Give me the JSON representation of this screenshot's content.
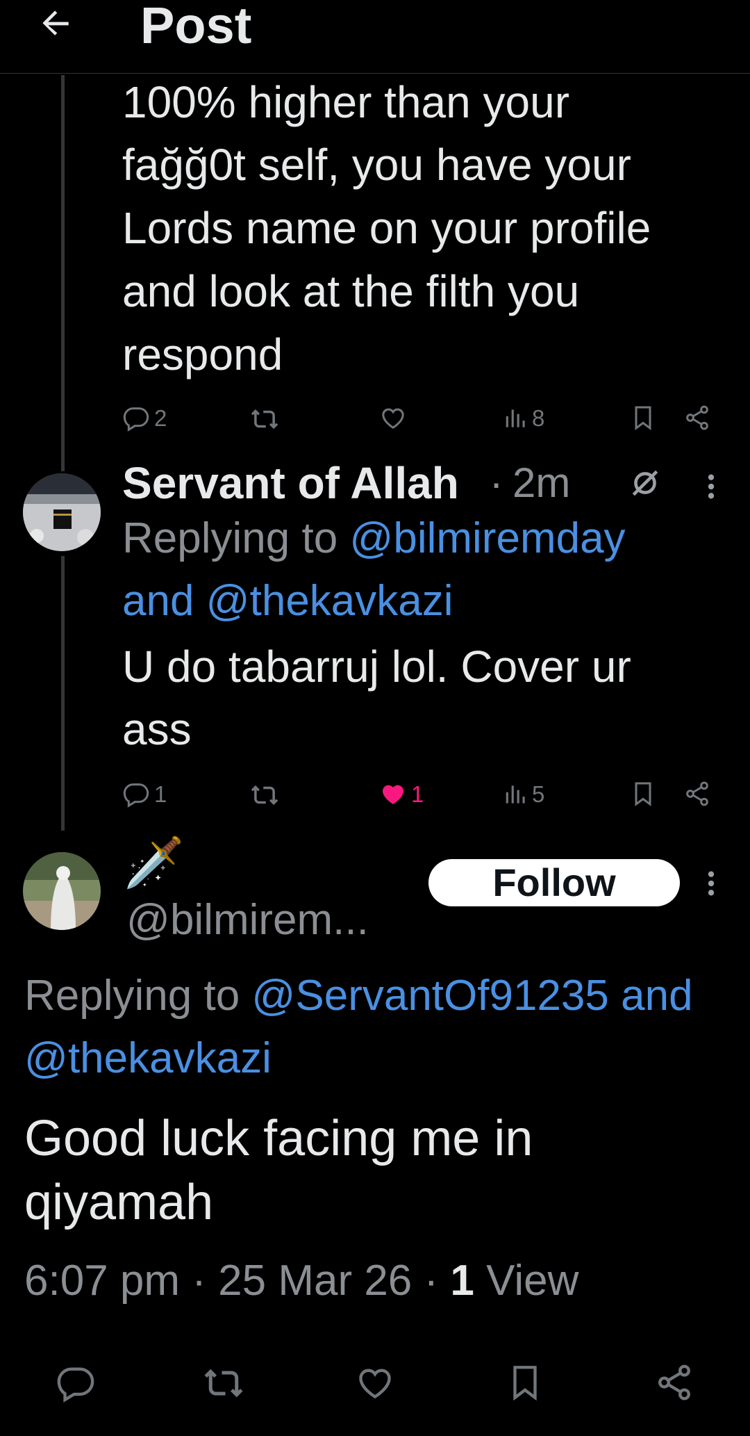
{
  "header": {
    "title": "Post"
  },
  "tweet1": {
    "text": "100% higher than your faggOt self, you have your Lords name on your profile and look at the filth you respond",
    "lines": [
      "100% higher than your",
      "fağğ0t self, you have your",
      "Lords name on your profile",
      "and look at the filth you",
      "respond"
    ],
    "replies": "2",
    "views": "8"
  },
  "tweet2": {
    "author": "Servant of Allah",
    "separator": " · ",
    "time": "2m",
    "replying_prefix": "Replying to ",
    "reply_handle1": "@bilmiremday",
    "reply_and": "and ",
    "reply_handle2": "@thekavkazi",
    "text_line1": "U do tabarruj lol. Cover ur",
    "text_line2": "ass",
    "replies": "1",
    "likes": "1",
    "views": "5"
  },
  "main_post": {
    "display_name_emoji": "🗡️",
    "handle": "@bilmirem...",
    "follow_label": "Follow",
    "replying_prefix": "Replying to ",
    "reply_handle1": "@ServantOf91235",
    "reply_and": " and",
    "reply_handle2": "@thekavkazi",
    "text_line1": "Good luck facing me in",
    "text_line2": "qiyamah",
    "time": "6:07 pm",
    "sep1": " · ",
    "date": "25 Mar 26",
    "sep2": " · ",
    "view_count": "1",
    "view_label": " View"
  },
  "colors": {
    "background": "#000000",
    "link": "#4a90e2",
    "like_active": "#f91880",
    "muted": "#8b8f94"
  },
  "icons": [
    "back-arrow-icon",
    "reply-icon",
    "retweet-icon",
    "like-icon",
    "views-icon",
    "bookmark-icon",
    "share-icon",
    "more-icon",
    "muted-grok-icon"
  ]
}
